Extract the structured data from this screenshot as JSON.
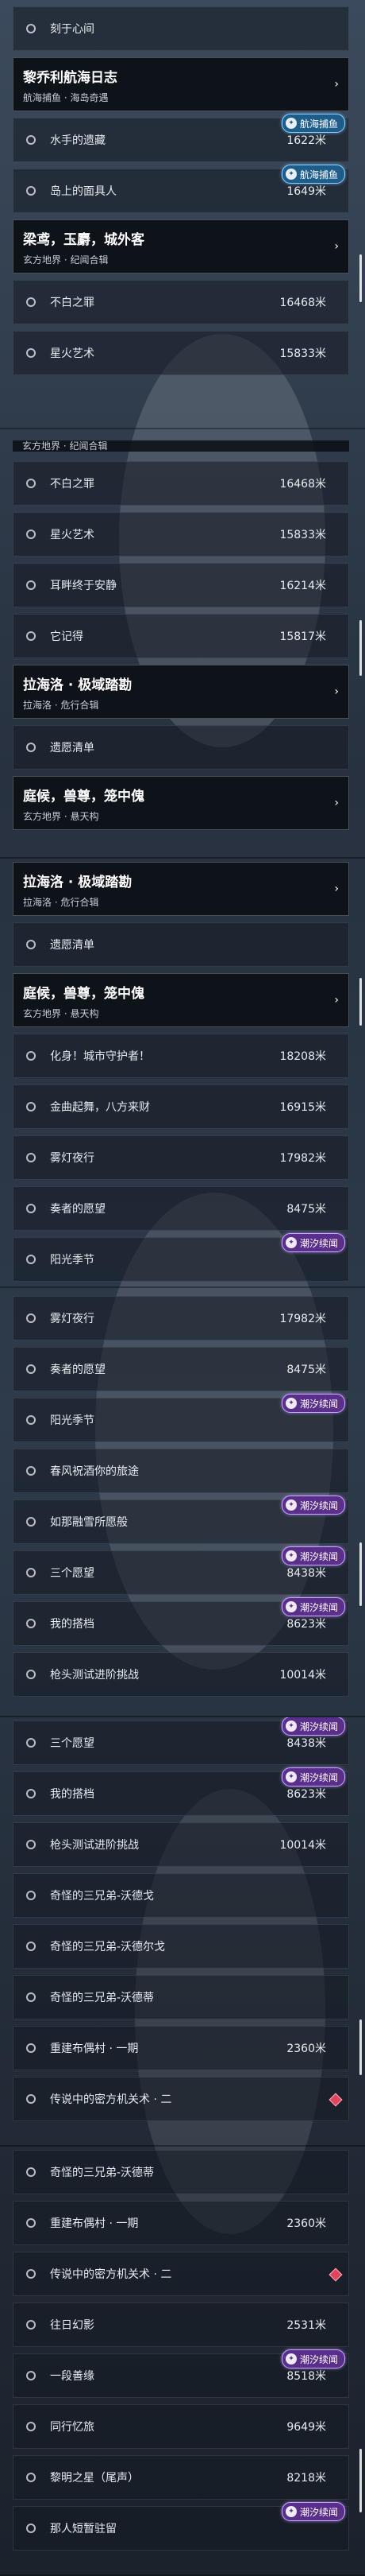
{
  "badges": {
    "hanghai": "航海捕鱼",
    "chaoxi": "潮汐续闻"
  },
  "strips": [
    {
      "items": [
        {
          "kind": "item",
          "name": "刻于心间",
          "dist": ""
        },
        {
          "kind": "group",
          "title": "黎乔利航海日志",
          "subtitle": "航海捕鱼 · 海岛奇遇"
        },
        {
          "kind": "item",
          "name": "水手的遗藏",
          "dist": "1622米",
          "badge": "hanghai"
        },
        {
          "kind": "item",
          "name": "岛上的面具人",
          "dist": "1649米",
          "badge": "hanghai"
        },
        {
          "kind": "group",
          "title": "梁鸢，玉麝，城外客",
          "subtitle": "玄方地界 · 纪闻合辑"
        },
        {
          "kind": "item",
          "name": "不白之罪",
          "dist": "16468米"
        },
        {
          "kind": "item",
          "name": "星火艺术",
          "dist": "15833米"
        }
      ]
    },
    {
      "ghost": "玄方地界 · 纪闻合辑",
      "items": [
        {
          "kind": "item",
          "name": "不白之罪",
          "dist": "16468米"
        },
        {
          "kind": "item",
          "name": "星火艺术",
          "dist": "15833米"
        },
        {
          "kind": "item",
          "name": "耳畔终于安静",
          "dist": "16214米"
        },
        {
          "kind": "item",
          "name": "它记得",
          "dist": "15817米"
        },
        {
          "kind": "group",
          "title": "拉海洛 · 极域踏勘",
          "subtitle": "拉海洛 · 危行合辑"
        },
        {
          "kind": "item",
          "name": "遗愿清单",
          "dist": ""
        },
        {
          "kind": "group",
          "title": "庭候，兽尊，笼中傀",
          "subtitle": "玄方地界 · 悬天构"
        }
      ]
    },
    {
      "items": [
        {
          "kind": "group",
          "title": "拉海洛 · 极域踏勘",
          "subtitle": "拉海洛 · 危行合辑"
        },
        {
          "kind": "item",
          "name": "遗愿清单",
          "dist": ""
        },
        {
          "kind": "group",
          "title": "庭候，兽尊，笼中傀",
          "subtitle": "玄方地界 · 悬天构"
        },
        {
          "kind": "item",
          "name": "化身！城市守护者！",
          "dist": "18208米"
        },
        {
          "kind": "item",
          "name": "金曲起舞，八方来财",
          "dist": "16915米"
        },
        {
          "kind": "item",
          "name": "雾灯夜行",
          "dist": "17982米"
        },
        {
          "kind": "item",
          "name": "奏者的愿望",
          "dist": "8475米"
        },
        {
          "kind": "item",
          "name": "阳光季节",
          "dist": "",
          "badge": "chaoxi"
        }
      ]
    },
    {
      "items": [
        {
          "kind": "item",
          "name": "雾灯夜行",
          "dist": "17982米"
        },
        {
          "kind": "item",
          "name": "奏者的愿望",
          "dist": "8475米"
        },
        {
          "kind": "item",
          "name": "阳光季节",
          "dist": "",
          "badge": "chaoxi"
        },
        {
          "kind": "item",
          "name": "春风祝酒你的旅途",
          "dist": ""
        },
        {
          "kind": "item",
          "name": "如那融雪所愿般",
          "dist": "",
          "badge": "chaoxi"
        },
        {
          "kind": "item",
          "name": "三个愿望",
          "dist": "8438米",
          "badge": "chaoxi"
        },
        {
          "kind": "item",
          "name": "我的搭档",
          "dist": "8623米",
          "badge": "chaoxi"
        },
        {
          "kind": "item",
          "name": "枪头测试进阶挑战",
          "dist": "10014米"
        }
      ]
    },
    {
      "items": [
        {
          "kind": "item",
          "name": "三个愿望",
          "dist": "8438米",
          "badge": "chaoxi"
        },
        {
          "kind": "item",
          "name": "我的搭档",
          "dist": "8623米",
          "badge": "chaoxi"
        },
        {
          "kind": "item",
          "name": "枪头测试进阶挑战",
          "dist": "10014米"
        },
        {
          "kind": "item",
          "name": "奇怪的三兄弟-沃德戈",
          "dist": ""
        },
        {
          "kind": "item",
          "name": "奇怪的三兄弟-沃德尔戈",
          "dist": ""
        },
        {
          "kind": "item",
          "name": "奇怪的三兄弟-沃德蒂",
          "dist": ""
        },
        {
          "kind": "item",
          "name": "重建布偶村 · 一期",
          "dist": "2360米"
        },
        {
          "kind": "item",
          "name": "传说中的密方机关术 · 二",
          "dist": "",
          "diamond": true
        }
      ]
    },
    {
      "items": [
        {
          "kind": "item",
          "name": "奇怪的三兄弟-沃德蒂",
          "dist": ""
        },
        {
          "kind": "item",
          "name": "重建布偶村 · 一期",
          "dist": "2360米"
        },
        {
          "kind": "item",
          "name": "传说中的密方机关术 · 二",
          "dist": "",
          "diamond": true
        },
        {
          "kind": "item",
          "name": "往日幻影",
          "dist": "2531米"
        },
        {
          "kind": "item",
          "name": "一段善缘",
          "dist": "8518米",
          "badge": "chaoxi"
        },
        {
          "kind": "item",
          "name": "同行忆旅",
          "dist": "9649米"
        },
        {
          "kind": "item",
          "name": "黎明之星（尾声）",
          "dist": "8218米"
        },
        {
          "kind": "item",
          "name": "那人短暂驻留",
          "dist": "",
          "badge": "chaoxi"
        }
      ]
    }
  ]
}
